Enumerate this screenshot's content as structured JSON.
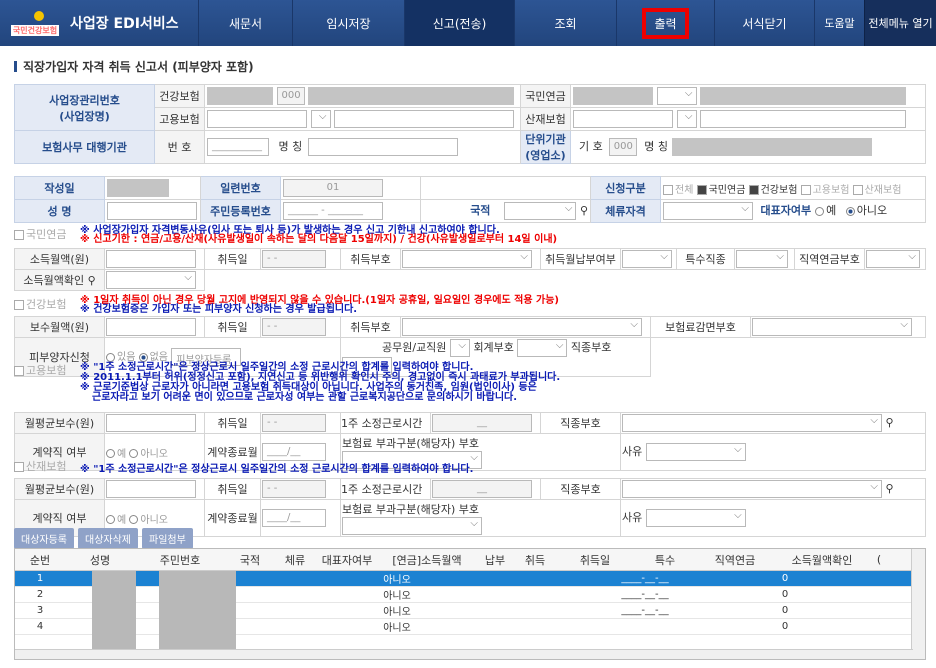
{
  "nav": {
    "logo_text": "국민건강보험",
    "brand": "사업장 EDI서비스",
    "items": [
      "새문서",
      "임시저장",
      "신고(전송)",
      "조회",
      "출력",
      "서식닫기"
    ],
    "help": "도움말",
    "menu_open": "전체메뉴 열기"
  },
  "title": "직장가입자 자격 취득 신고서 (피부양자 포함)",
  "biz": {
    "label_main": "사업장관리번호",
    "label_sub": "(사업장명)",
    "health": "건강보험",
    "health_code": "000",
    "pension": "국민연금",
    "employ": "고용보험",
    "industrial": "산재보험",
    "agency_label": "보험사무 대행기관",
    "num_label": "번 호",
    "num_placeholder": "__________",
    "name_label": "명 칭",
    "unit_label": "단위기관 (영업소)",
    "code_label": "기 호",
    "code_value": "000",
    "name2_label": "명 칭"
  },
  "form": {
    "date_label": "작성일",
    "seq_label": "일련번호",
    "seq_value": "01",
    "apply_label": "신청구분",
    "apply_opts": [
      "전체",
      "국민연금",
      "건강보험",
      "고용보험",
      "산재보험"
    ],
    "name_label": "성 명",
    "rrn_label": "주민등록번호",
    "rrn_value": "______ - _______",
    "nation_label": "국적",
    "stay_label": "체류자격",
    "rep_label": "대표자여부",
    "rep_yes": "예",
    "rep_no": "아니오"
  },
  "pension": {
    "hd": "국민연금",
    "note1": "※ 사업장가입자 자격변동사유(입사 또는 퇴사 등)가 발생하는 경우 신고 기한내 신고하여야 합니다.",
    "note2": "※ 신고기한 : 연금/고용/산재(사유발생일이 속하는 달의 다음달 15일까지) / 건강(사유발생일로부터 14일 이내)",
    "income_label": "소득월액(원)",
    "acq_date_label": "취득일",
    "date_placeholder": "- -",
    "acq_code_label": "취득부호",
    "pay_label": "취득월납부여부",
    "special_label": "특수직종",
    "pension_code_label": "직역연금부호",
    "income_check_label": "소득월액확인"
  },
  "health": {
    "hd": "건강보험",
    "note1": "※ 1일자 취득이 아닌 경우 당월 고지에 반영되지 않을 수 있습니다.(1일자 공휴일, 일요일인 경우에도 적용 가능)",
    "note2": "※ 건강보험증은 가입자 또는 피부양자 신청하는 경우 발급됩니다.",
    "pay_label": "보수월액(원)",
    "acq_date_label": "취득일",
    "date_placeholder": "- -",
    "acq_code_label": "취득부호",
    "reduce_label": "보험료감면부호",
    "dep_label": "피부양자신청",
    "dep_yes": "있음",
    "dep_no": "없음",
    "dep_btn": "피부양자등록",
    "official_label": "공무원/교직원",
    "acct_label": "회계부호",
    "job_label": "직종부호"
  },
  "employ": {
    "hd": "고용보험",
    "note1": "※ \"1주 소정근로시간\"은 정상근로시 일주일간의  소정 근로시간의 합계를 입력하여야 합니다.",
    "note2": "※ 2011.1.1부터 허위(정정신고 포함), 지연신고 등 위반행위 확인시 주의, 경고없이 즉시 과태료가 부과됩니다.",
    "note3": "※ 근로기준법상 근로자가 아니라면 고용보험 취득대상이 아닙니다. 사업주의 동거친족, 임원(법인이사) 등은",
    "note4": "근로자라고 보기 어려운 면이 있으므로 근로자성 여부는 관할 근로복지공단으로 문의하시기 바랍니다.",
    "avg_label": "월평균보수(원)",
    "acq_date_label": "취득일",
    "date_placeholder": "- -",
    "hours_label": "1주 소정근로시간",
    "hours_placeholder": "__",
    "job_label": "직종부호",
    "contract_label": "계약직 여부",
    "yes": "예",
    "no": "아니오",
    "end_label": "계약종료월",
    "end_placeholder": "____/__",
    "exempt_label": "보험료 부과구분(해당자)",
    "code_label": "부호",
    "reason_label": "사유"
  },
  "industrial": {
    "hd": "산재보험",
    "note1": "※ \"1주 소정근로시간\"은 정상근로시 일주일간의  소정 근로시간의 합계를 입력하여야 합니다.",
    "avg_label": "월평균보수(원)",
    "acq_date_label": "취득일",
    "date_placeholder": "- -",
    "hours_label": "1주 소정근로시간",
    "hours_placeholder": "__",
    "job_label": "직종부호",
    "contract_label": "계약직 여부",
    "yes": "예",
    "no": "아니오",
    "end_label": "계약종료월",
    "end_placeholder": "____/__",
    "exempt_label": "보험료 부과구분(해당자)",
    "code_label": "부호",
    "reason_label": "사유"
  },
  "buttons": [
    "대상자등록",
    "대상자삭제",
    "파일첨부"
  ],
  "grid": {
    "cols": [
      "순번",
      "성명",
      "주민번호",
      "국적",
      "체류",
      "대표자여부",
      "[연금]소득월액",
      "납부",
      "취득",
      "취득일",
      "특수",
      "직역연금",
      "소득월액확인",
      "("
    ],
    "rows": [
      {
        "seq": "1",
        "rep": "아니오",
        "date": "____-__-__",
        "pension": "0"
      },
      {
        "seq": "2",
        "rep": "아니오",
        "date": "____-__-__",
        "pension": "0"
      },
      {
        "seq": "3",
        "rep": "아니오",
        "date": "____-__-__",
        "pension": "0"
      },
      {
        "seq": "4",
        "rep": "아니오",
        "date": "",
        "pension": "0"
      }
    ]
  }
}
